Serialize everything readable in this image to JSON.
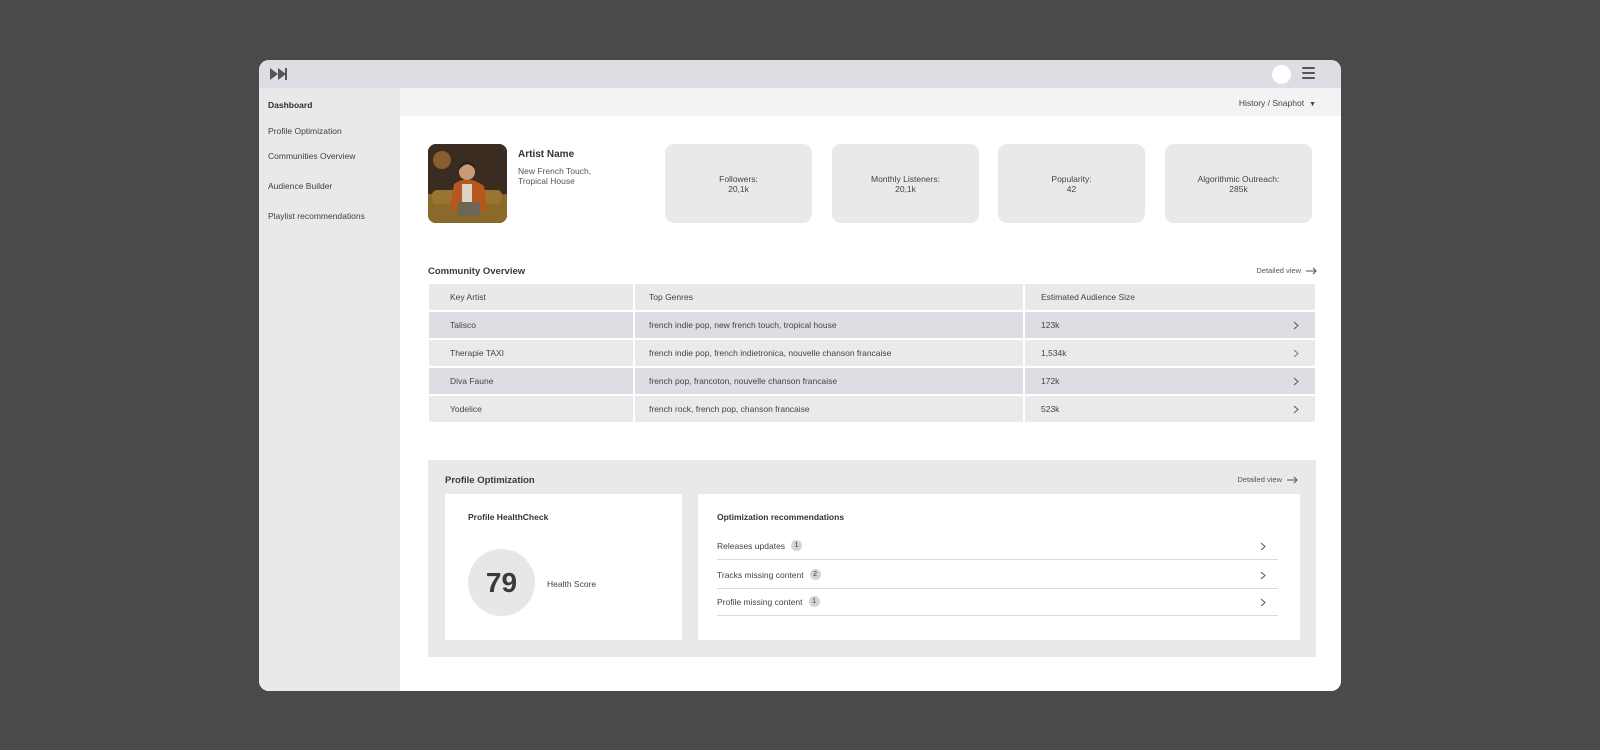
{
  "sidebar": {
    "items": [
      {
        "label": "Dashboard"
      },
      {
        "label": "Profile Optimization"
      },
      {
        "label": "Communities Overview"
      },
      {
        "label": "Audience Builder"
      },
      {
        "label": "Playlist recommendations"
      }
    ]
  },
  "header": {
    "history_label": "History  / Snaphot",
    "caret": "▼"
  },
  "artist": {
    "name": "Artist Name",
    "genre_line1": "New French Touch,",
    "genre_line2": "Tropical House"
  },
  "stats": [
    {
      "label": "Followers:",
      "value": "20,1k"
    },
    {
      "label": "Monthly Listeners:",
      "value": "20,1k"
    },
    {
      "label": "Popularity:",
      "value": "42"
    },
    {
      "label": "Algorithmic Outreach:",
      "value": "285k"
    }
  ],
  "community": {
    "title": "Community Overview",
    "detail_link": "Detailed view",
    "columns": [
      "Key Artist",
      "Top Genres",
      "Estimated Audience Size"
    ],
    "rows": [
      {
        "artist": "Talisco",
        "genres": "french indie pop, new french touch,  tropical house",
        "size": "123k"
      },
      {
        "artist": "Therapie TAXI",
        "genres": "french indie pop, french indietronica, nouvelle chanson francaise",
        "size": "1,534k"
      },
      {
        "artist": "Diva Faune",
        "genres": "french pop, francoton, nouvelle chanson francaise",
        "size": "172k"
      },
      {
        "artist": "Yodelice",
        "genres": "french rock, french pop, chanson francaise",
        "size": "523k"
      }
    ]
  },
  "optimization": {
    "title": "Profile Optimization",
    "detail_link": "Detailed view",
    "health": {
      "title": "Profile HealthCheck",
      "score": "79",
      "score_label": "Health Score"
    },
    "recommendations": {
      "title": "Optimization recommendations",
      "items": [
        {
          "label": "Releases updates",
          "count": "1"
        },
        {
          "label": "Tracks missing content",
          "count": "2"
        },
        {
          "label": "Profile missing content",
          "count": "1"
        }
      ]
    }
  },
  "colors": {
    "page_bg": "#4a4a4a",
    "topbar": "#dcdee4",
    "sidebar": "#e9e9ea",
    "card": "#e9e9e9",
    "row_highlight": "#dcdee4"
  }
}
